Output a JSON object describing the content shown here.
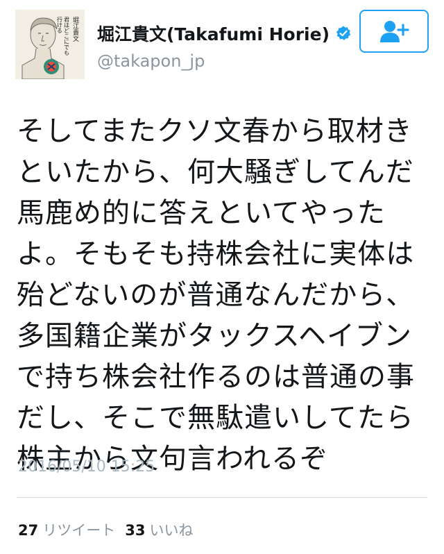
{
  "user": {
    "display_name": "堀江貴文(Takafumi Horie)",
    "handle": "@takapon_jp",
    "verified": true,
    "avatar_icon": "book-cover-avatar",
    "avatar_text": [
      "堀江貴文",
      "君はどこにでも",
      "行ける"
    ]
  },
  "follow_button": {
    "icon": "add-user-icon",
    "color": "#1da1f2"
  },
  "tweet": {
    "lines": [
      "そしてまたクソ文春から取材き",
      "といたから、何大騒ぎしてんだ",
      "馬鹿め的に答えといてやった",
      "よ。そもそも持株会社に実体は",
      "殆どないのが普通なんだから、",
      "多国籍企業がタックスヘイブン",
      "で持ち株会社作るのは普通の事",
      "だし、そこで無駄遣いしてたら",
      "株主から文句言われるぞ"
    ],
    "timestamp": "2016/05/10 15:25"
  },
  "stats": {
    "retweets_count": "27",
    "retweets_label": "リツイート",
    "likes_count": "33",
    "likes_label": "いいね"
  }
}
